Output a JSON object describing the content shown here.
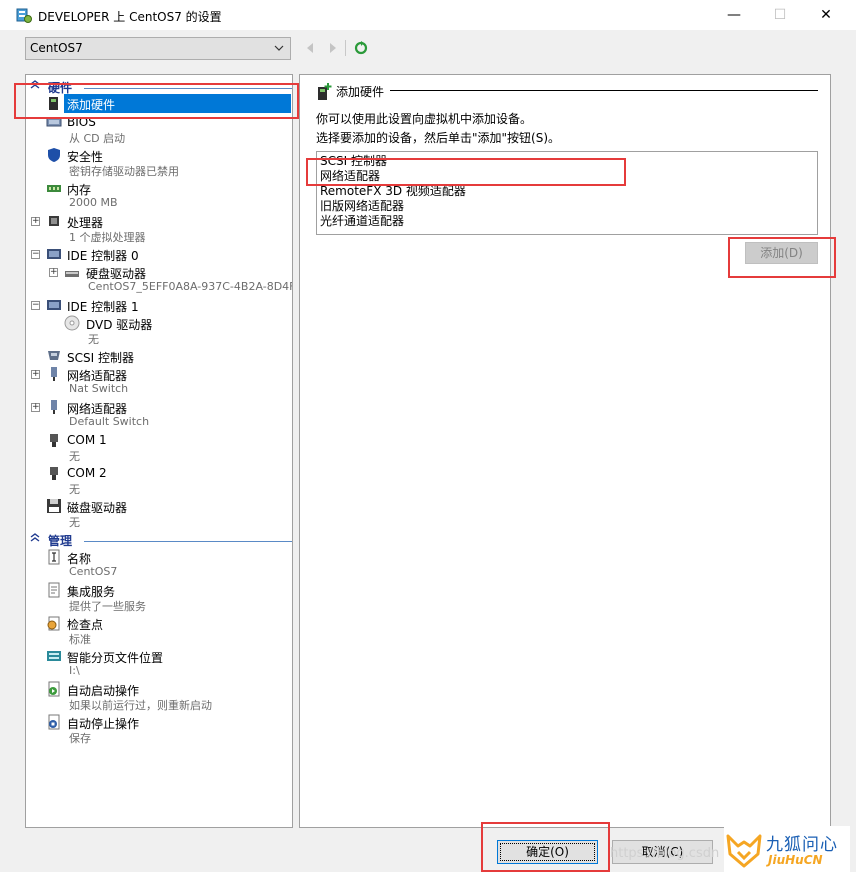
{
  "window": {
    "title": "DEVELOPER 上 CentOS7 的设置",
    "minimize": "—",
    "maximize": "☐",
    "close": "✕"
  },
  "vm_select": {
    "value": "CentOS7"
  },
  "sidebar": {
    "hardware_header": "硬件",
    "management_header": "管理",
    "items": [
      {
        "label": "添加硬件",
        "sub": ""
      },
      {
        "label": "BIOS",
        "sub": "从 CD 启动"
      },
      {
        "label": "安全性",
        "sub": "密钥存储驱动器已禁用"
      },
      {
        "label": "内存",
        "sub": "2000 MB"
      },
      {
        "label": "处理器",
        "sub": "1 个虚拟处理器"
      },
      {
        "label": "IDE 控制器 0",
        "sub": ""
      },
      {
        "label": "硬盘驱动器",
        "sub": "CentOS7_5EFF0A8A-937C-4B2A-8D4F..."
      },
      {
        "label": "IDE 控制器 1",
        "sub": ""
      },
      {
        "label": "DVD 驱动器",
        "sub": "无"
      },
      {
        "label": "SCSI 控制器",
        "sub": ""
      },
      {
        "label": "网络适配器",
        "sub": "Nat Switch"
      },
      {
        "label": "网络适配器",
        "sub": "Default Switch"
      },
      {
        "label": "COM 1",
        "sub": "无"
      },
      {
        "label": "COM 2",
        "sub": "无"
      },
      {
        "label": "磁盘驱动器",
        "sub": "无"
      }
    ],
    "management_items": [
      {
        "label": "名称",
        "sub": "CentOS7"
      },
      {
        "label": "集成服务",
        "sub": "提供了一些服务"
      },
      {
        "label": "检查点",
        "sub": "标准"
      },
      {
        "label": "智能分页文件位置",
        "sub": "I:\\"
      },
      {
        "label": "自动启动操作",
        "sub": "如果以前运行过，则重新启动"
      },
      {
        "label": "自动停止操作",
        "sub": "保存"
      }
    ]
  },
  "panel": {
    "title": "添加硬件",
    "line1": "你可以使用此设置向虚拟机中添加设备。",
    "line2": "选择要添加的设备，然后单击\"添加\"按钮(S)。",
    "devices": [
      "SCSI 控制器",
      "网络适配器",
      "RemoteFX 3D 视频适配器",
      "旧版网络适配器",
      "光纤通道适配器"
    ],
    "add_button": "添加(D)"
  },
  "footer": {
    "ok_button": "确定(O)",
    "cancel_button": "取消(C)"
  },
  "watermark": {
    "brand_cn": "九狐问心",
    "brand_en": "JiuHuCN",
    "faint_text": "https://blog.csdn"
  },
  "colors": {
    "selection": "#0078d7",
    "section_header": "#1f3a8f",
    "highlight": "#e53b3b",
    "brand_orange": "#f5a623",
    "brand_blue": "#1a5fb4"
  }
}
